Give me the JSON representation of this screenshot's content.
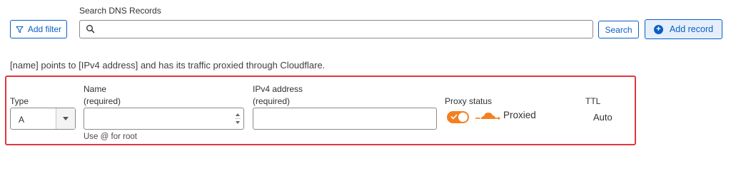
{
  "toolbar": {
    "add_filter_label": "Add filter",
    "search_label": "Search DNS Records",
    "search_value": "",
    "search_button_label": "Search",
    "add_record_label": "Add record"
  },
  "description": "[name] points to [IPv4 address] and has its traffic proxied through Cloudflare.",
  "record_form": {
    "type_label": "Type",
    "type_value": "A",
    "name_label": "Name",
    "name_required": "(required)",
    "name_value": "",
    "name_hint": "Use @ for root",
    "ipv4_label": "IPv4 address",
    "ipv4_required": "(required)",
    "ipv4_value": "",
    "proxy_status_label": "Proxy status",
    "proxy_enabled": true,
    "proxy_value": "Proxied",
    "ttl_label": "TTL",
    "ttl_value": "Auto"
  },
  "colors": {
    "accent_blue": "#0b5fc4",
    "highlight_red": "#e0373d",
    "cloudflare_orange": "#f38020"
  },
  "icons": [
    "filter-icon",
    "search-icon",
    "plus-circle-icon",
    "chevron-down-icon",
    "spinner-arrows-icon",
    "check-icon",
    "cloud-proxied-icon"
  ]
}
